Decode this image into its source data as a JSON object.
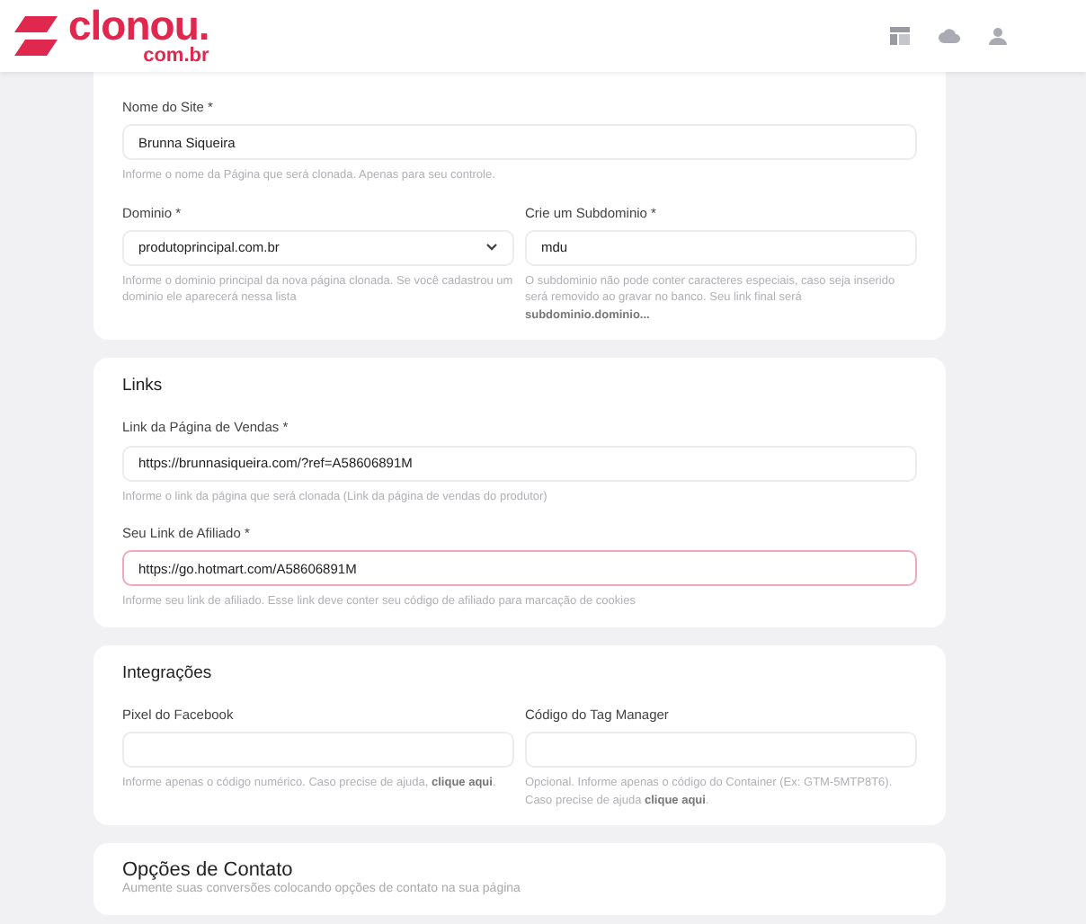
{
  "header": {
    "logo_text": "clonou.",
    "logo_subtext": "com.br"
  },
  "sections": [
    {
      "rows": [
        [
          {
            "label": "Nome do Site *",
            "kind": "input",
            "value": "Brunna Siqueira",
            "focused": false,
            "help": "Informe o nome da Página que será clonada. Apenas para seu controle."
          }
        ],
        [
          {
            "label": "Dominio *",
            "kind": "select",
            "value": "produtoprincipal.com.br",
            "focused": false,
            "help": "Informe o dominio principal da nova página clonada. Se você cadastrou um dominio ele aparecerá nessa lista"
          },
          {
            "label": "Crie um Subdominio *",
            "kind": "input",
            "value": "mdu",
            "focused": false,
            "help": "O subdominio não pode conter caracteres especiais, caso seja inserido será removido ao gravar no banco. Seu link final será **subdominio.dominio...**"
          }
        ]
      ]
    },
    {
      "title": "Links",
      "rows": [
        [
          {
            "label": "Link da Página de Vendas *",
            "kind": "input",
            "value": "https://brunnasiqueira.com/?ref=A58606891M",
            "focused": false,
            "help": "Informe o link da página que será clonada (Link da página de vendas do produtor)"
          }
        ],
        [
          {
            "label": "Seu Link de Afiliado *",
            "kind": "input",
            "value": "https://go.hotmart.com/A58606891M",
            "focused": true,
            "help": "Informe seu link de afiliado. Esse link deve conter seu código de afiliado para marcação de cookies"
          }
        ]
      ]
    },
    {
      "title": "Integrações",
      "rows": [
        [
          {
            "label": "Pixel do Facebook",
            "kind": "input",
            "focused": false,
            "help": "Informe apenas o código numérico. Caso precise de ajuda, **clique aqui**."
          },
          {
            "label": "Código do Tag Manager",
            "kind": "input",
            "focused": false,
            "help": "Opcional. Informe apenas o código do Container (Ex: GTM-5MTP8T6). Caso precise de ajuda **clique aqui**."
          }
        ]
      ]
    },
    {
      "title": "Opções de Contato",
      "subtitle": "Aumente suas conversões colocando opções de contato na sua página"
    }
  ]
}
